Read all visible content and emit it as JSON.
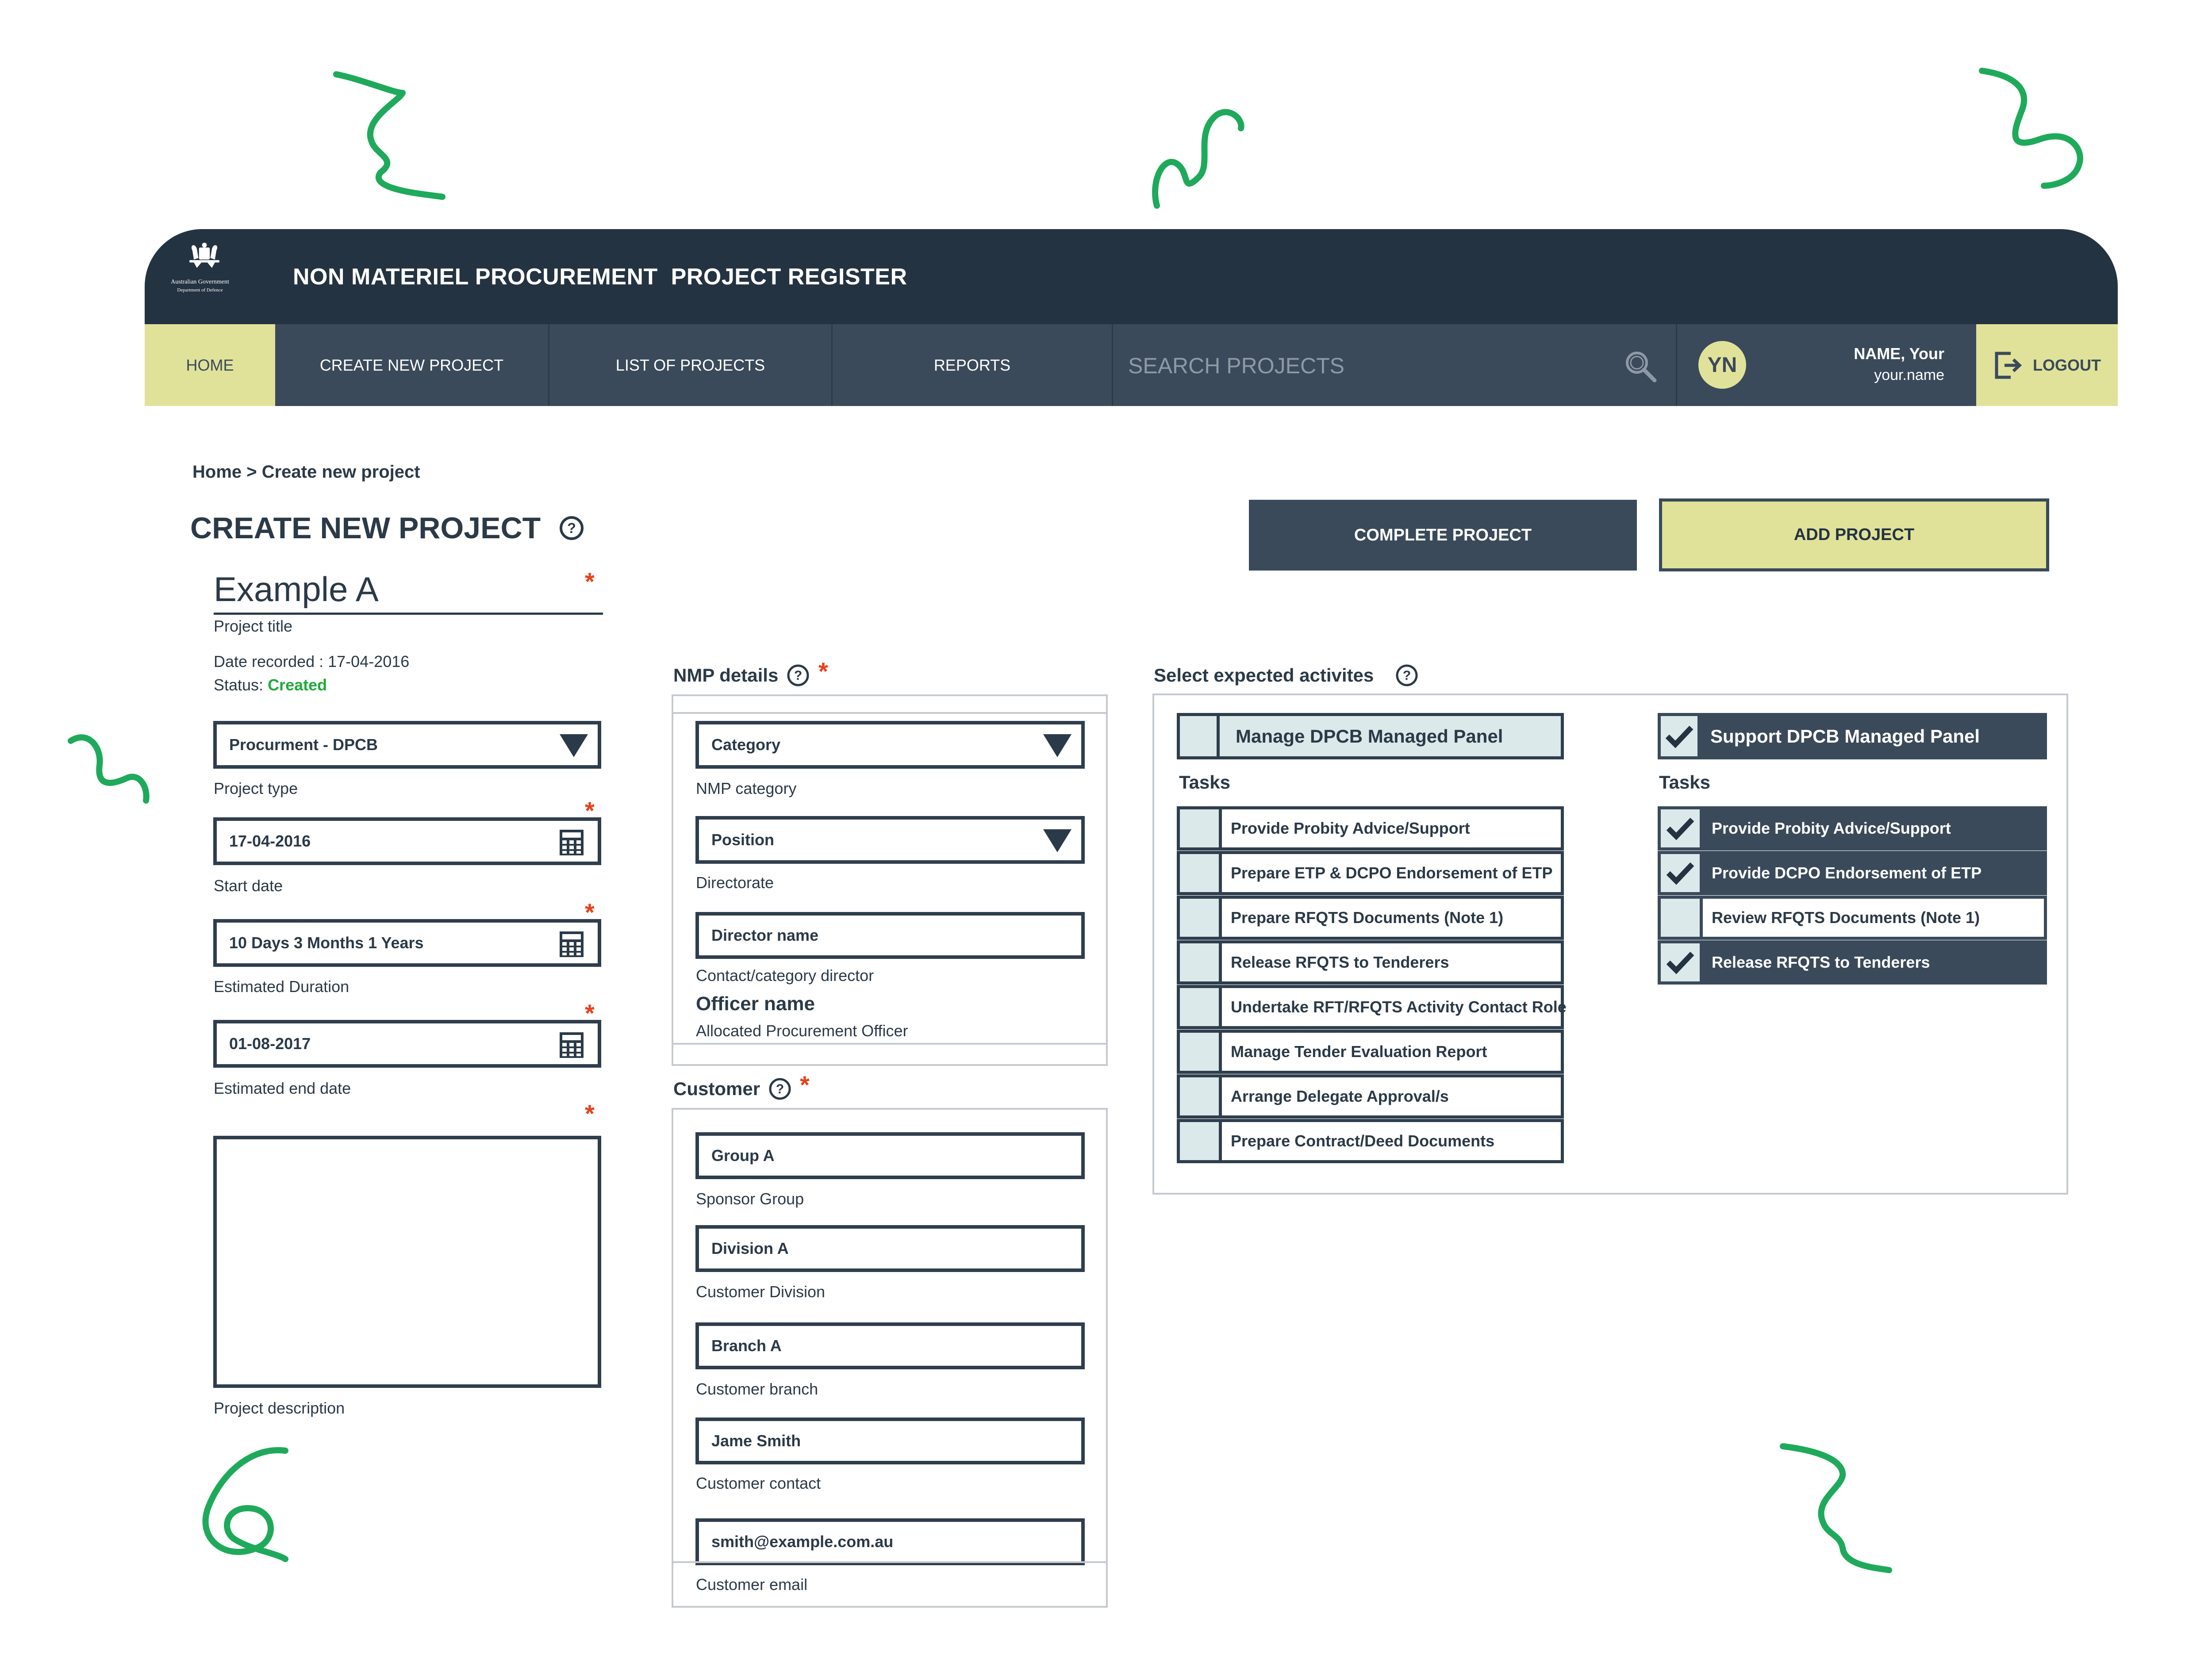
{
  "header": {
    "crest_line1": "Australian Government",
    "crest_line2": "Department of Defence",
    "app_title": "NON MATERIEL PROCUREMENT  PROJECT REGISTER"
  },
  "nav": {
    "home": "HOME",
    "create": "CREATE NEW PROJECT",
    "list": "LIST OF PROJECTS",
    "reports": "REPORTS",
    "search_placeholder": "SEARCH PROJECTS",
    "avatar_initials": "YN",
    "user_name": "NAME, Your",
    "user_id": "your.name",
    "logout": "LOGOUT"
  },
  "breadcrumb": "Home > Create new project",
  "page_title": "CREATE NEW PROJECT",
  "actions": {
    "complete": "COMPLETE PROJECT",
    "add": "ADD PROJECT"
  },
  "project": {
    "title_value": "Example A",
    "title_label": "Project title",
    "date_recorded": "Date recorded : 17-04-2016",
    "status_label": "Status: ",
    "status_value": "Created",
    "type_value": "Procurment - DPCB",
    "type_label": "Project type",
    "start_value": "17-04-2016",
    "start_label": "Start date",
    "duration_value": "10 Days 3 Months 1 Years",
    "duration_label": "Estimated Duration",
    "end_value": "01-08-2017",
    "end_label": "Estimated end date",
    "description_label": "Project description",
    "required_mark": "*"
  },
  "nmp": {
    "heading": "NMP details",
    "category_value": "Category",
    "category_label": "NMP category",
    "position_value": "Position",
    "position_label": "Directorate",
    "director_value": "Director name",
    "director_label": "Contact/category director",
    "officer_value": "Officer name",
    "officer_label": "Allocated Procurement Officer"
  },
  "customer": {
    "heading": "Customer",
    "group_value": "Group A",
    "group_label": "Sponsor Group",
    "division_value": "Division A",
    "division_label": "Customer Division",
    "branch_value": "Branch A",
    "branch_label": "Customer branch",
    "contact_value": "Jame Smith",
    "contact_label": "Customer contact",
    "email_value": "smith@example.com.au",
    "email_label": "Customer email"
  },
  "activities": {
    "heading": "Select expected activites",
    "tasks_label": "Tasks",
    "manage": {
      "title": "Manage DPCB Managed Panel",
      "checked": false,
      "tasks": [
        {
          "label": "Provide Probity Advice/Support",
          "checked": false
        },
        {
          "label": "Prepare ETP & DCPO Endorsement of ETP",
          "checked": false
        },
        {
          "label": "Prepare RFQTS Documents (Note 1)",
          "checked": false
        },
        {
          "label": "Release RFQTS to Tenderers",
          "checked": false
        },
        {
          "label": "Undertake RFT/RFQTS Activity Contact Role",
          "checked": false
        },
        {
          "label": "Manage Tender Evaluation Report",
          "checked": false
        },
        {
          "label": "Arrange Delegate Approval/s",
          "checked": false
        },
        {
          "label": "Prepare Contract/Deed Documents",
          "checked": false
        }
      ]
    },
    "support": {
      "title": "Support  DPCB Managed Panel",
      "checked": true,
      "tasks": [
        {
          "label": "Provide Probity Advice/Support",
          "checked": true
        },
        {
          "label": "Provide DCPO Endorsement of ETP",
          "checked": true
        },
        {
          "label": "Review RFQTS Documents (Note 1)",
          "checked": false
        },
        {
          "label": "Release RFQTS to Tenderers",
          "checked": true
        }
      ]
    }
  },
  "colors": {
    "navy": "#243341",
    "slate": "#3a4a5a",
    "accent_yellow": "#e0e29a",
    "checkbox_bg": "#dbe9ea",
    "required_red": "#e8401a",
    "status_green": "#1faa3a",
    "squiggle_green": "#1faa5b"
  }
}
